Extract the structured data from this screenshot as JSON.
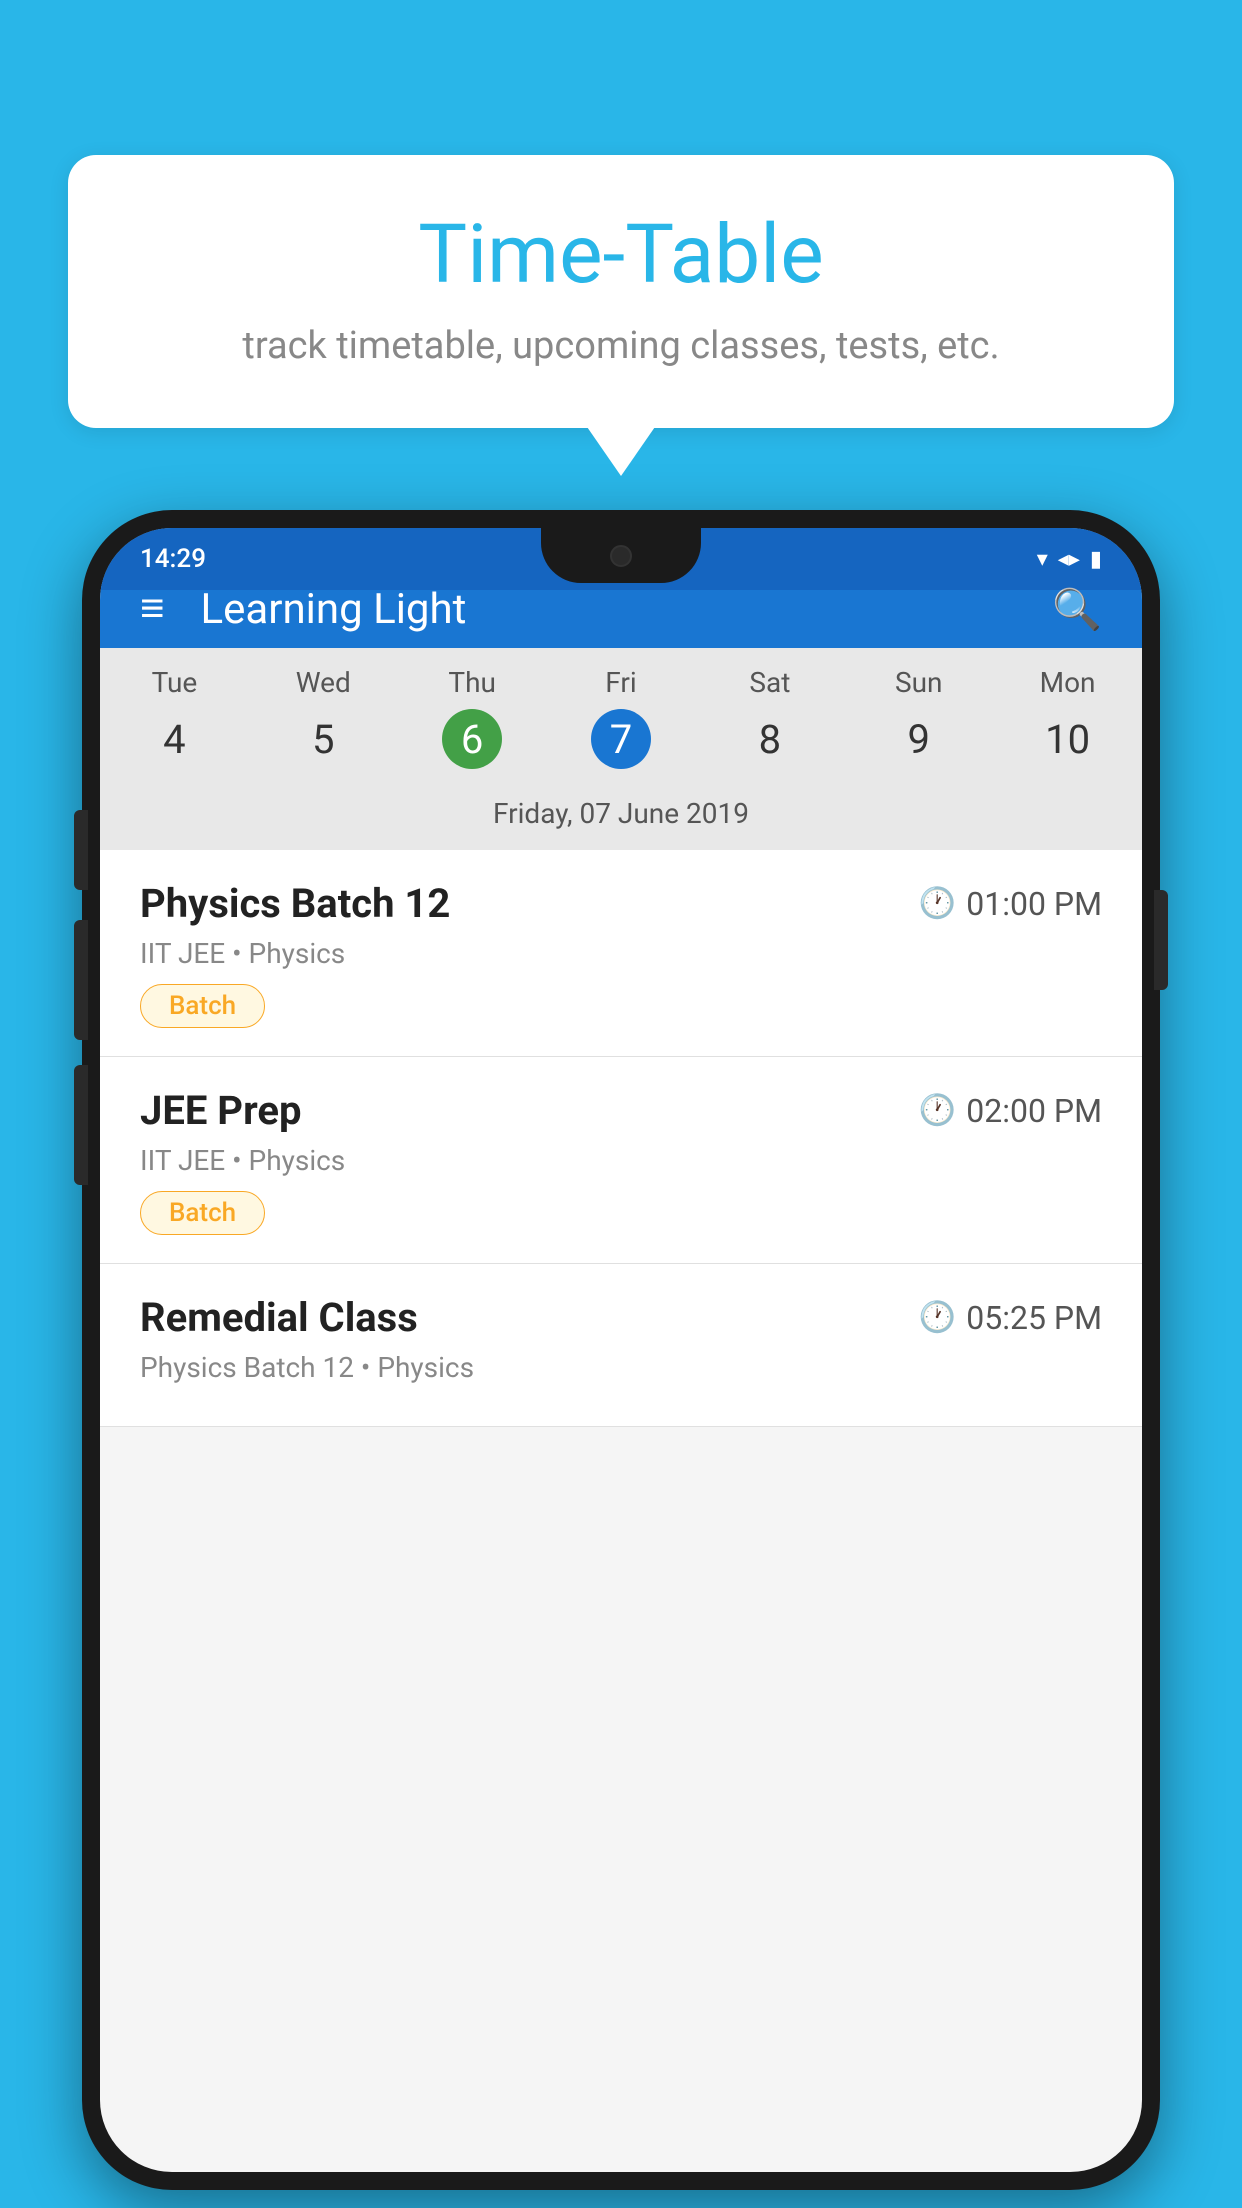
{
  "background_color": "#29B6E8",
  "speech_bubble": {
    "title": "Time-Table",
    "subtitle": "track timetable, upcoming classes, tests, etc."
  },
  "status_bar": {
    "time": "14:29"
  },
  "app_bar": {
    "title": "Learning Light"
  },
  "calendar": {
    "selected_date_label": "Friday, 07 June 2019",
    "days": [
      {
        "name": "Tue",
        "num": "4",
        "state": "normal"
      },
      {
        "name": "Wed",
        "num": "5",
        "state": "normal"
      },
      {
        "name": "Thu",
        "num": "6",
        "state": "today"
      },
      {
        "name": "Fri",
        "num": "7",
        "state": "selected"
      },
      {
        "name": "Sat",
        "num": "8",
        "state": "normal"
      },
      {
        "name": "Sun",
        "num": "9",
        "state": "normal"
      },
      {
        "name": "Mon",
        "num": "10",
        "state": "normal"
      }
    ]
  },
  "schedule_items": [
    {
      "title": "Physics Batch 12",
      "time": "01:00 PM",
      "subtitle": "IIT JEE • Physics",
      "badge": "Batch"
    },
    {
      "title": "JEE Prep",
      "time": "02:00 PM",
      "subtitle": "IIT JEE • Physics",
      "badge": "Batch"
    },
    {
      "title": "Remedial Class",
      "time": "05:25 PM",
      "subtitle": "Physics Batch 12 • Physics",
      "badge": null
    }
  ],
  "icons": {
    "hamburger": "≡",
    "search": "🔍",
    "clock": "🕐",
    "wifi": "▼",
    "signal": "▲",
    "battery": "▮"
  }
}
